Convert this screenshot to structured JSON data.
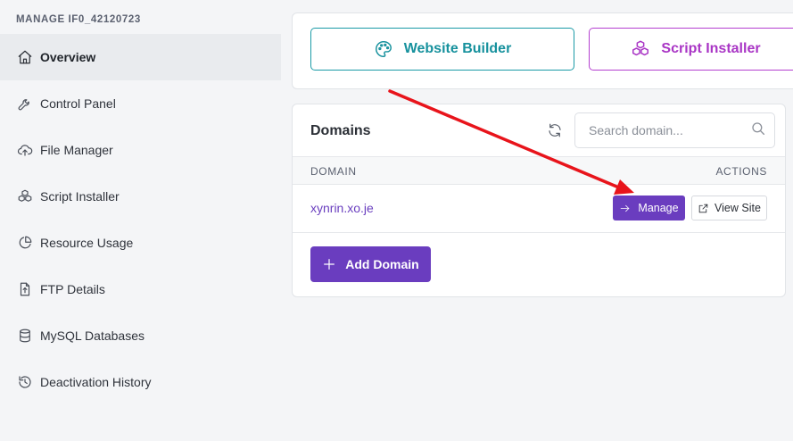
{
  "sidebar": {
    "title": "MANAGE IF0_42120723",
    "items": [
      {
        "label": "Overview",
        "icon": "home-icon",
        "active": true
      },
      {
        "label": "Control Panel",
        "icon": "wrench-icon"
      },
      {
        "label": "File Manager",
        "icon": "cloud-upload-icon"
      },
      {
        "label": "Script Installer",
        "icon": "cubes-icon"
      },
      {
        "label": "Resource Usage",
        "icon": "pie-chart-icon"
      },
      {
        "label": "FTP Details",
        "icon": "file-upload-icon"
      },
      {
        "label": "MySQL Databases",
        "icon": "database-icon"
      },
      {
        "label": "Deactivation History",
        "icon": "history-icon"
      }
    ]
  },
  "tools": {
    "website_builder": {
      "label": "Website Builder",
      "icon": "palette-icon",
      "color": "#16919d"
    },
    "script_installer": {
      "label": "Script Installer",
      "icon": "cubes-icon",
      "color": "#a935c5"
    }
  },
  "domains": {
    "title": "Domains",
    "search_placeholder": "Search domain...",
    "columns": {
      "domain": "DOMAIN",
      "actions": "ACTIONS"
    },
    "rows": [
      {
        "domain": "xynrin.xo.je",
        "manage_label": "Manage",
        "view_label": "View Site"
      }
    ],
    "add_label": "Add Domain",
    "accent": "#6a3dbf"
  },
  "annotation": {
    "arrow_color": "#e8141b"
  }
}
